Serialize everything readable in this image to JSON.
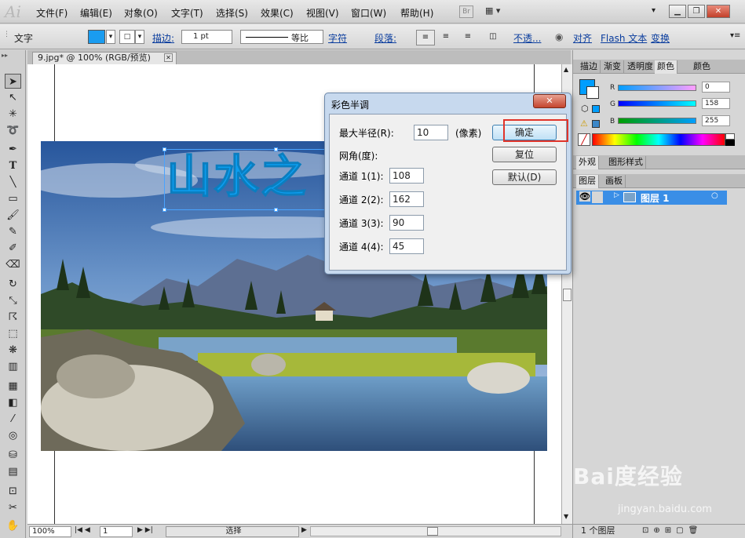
{
  "app": {
    "logo": "Ai"
  },
  "menu": [
    "文件(F)",
    "编辑(E)",
    "对象(O)",
    "文字(T)",
    "选择(S)",
    "效果(C)",
    "视图(V)",
    "窗口(W)",
    "帮助(H)"
  ],
  "bridge_icon": "Br",
  "window_controls": {
    "min": "▁",
    "restore": "❐",
    "close": "✕"
  },
  "controlbar": {
    "tool_label": "文字",
    "stroke_label": "描边:",
    "stroke_weight": "1 pt",
    "stroke_style": "等比",
    "char_link": "字符",
    "para_label": "段落:",
    "opacity_link": "不透...",
    "align_link": "对齐",
    "flash_text_link": "Flash 文本",
    "transform_link": "变换"
  },
  "document": {
    "tab_title": "9.jpg* @ 100% (RGB/预览)",
    "close_glyph": "✕"
  },
  "artwork": {
    "headline_text": "山水之"
  },
  "tools": [
    "selection-tool",
    "direct-selection-tool",
    "magic-wand-tool",
    "lasso-tool",
    "pen-tool",
    "type-tool",
    "line-tool",
    "rectangle-tool",
    "paintbrush-tool",
    "pencil-tool",
    "blob-brush-tool",
    "eraser-tool",
    "rotate-tool",
    "scale-tool",
    "warp-tool",
    "free-transform-tool",
    "symbol-sprayer-tool",
    "column-graph-tool",
    "mesh-tool",
    "gradient-tool",
    "eyedropper-tool",
    "blend-tool",
    "live-paint-tool",
    "slice-tool",
    "artboard-tool",
    "scissors-tool",
    "hand-tool"
  ],
  "statusbar": {
    "zoom": "100%",
    "page": "1",
    "mode": "选择"
  },
  "panels": {
    "top_tabs": [
      "描边",
      "渐变",
      "透明度",
      "颜色",
      "颜色"
    ],
    "color": {
      "channels": [
        {
          "label": "R",
          "value": "0"
        },
        {
          "label": "G",
          "value": "158"
        },
        {
          "label": "B",
          "value": "255"
        }
      ],
      "fill_color": "#009eff"
    },
    "mid_tabs": [
      "外观",
      "图形样式"
    ],
    "layer_tabs": [
      "图层",
      "画板"
    ],
    "layer_name": "图层 1",
    "layer_count": "1 个图层"
  },
  "dialog": {
    "title": "彩色半调",
    "close_glyph": "✕",
    "max_radius_label": "最大半径(R):",
    "max_radius_value": "10",
    "max_radius_unit": "(像素)",
    "screen_angles_label": "网角(度):",
    "channels": [
      {
        "label": "通道 1(1):",
        "value": "108"
      },
      {
        "label": "通道 2(2):",
        "value": "162"
      },
      {
        "label": "通道 3(3):",
        "value": "90"
      },
      {
        "label": "通道 4(4):",
        "value": "45"
      }
    ],
    "ok": "确定",
    "reset": "复位",
    "default": "默认(D)"
  },
  "watermark": {
    "brand": "Bai度经验",
    "url": "jingyan.baidu.com"
  }
}
